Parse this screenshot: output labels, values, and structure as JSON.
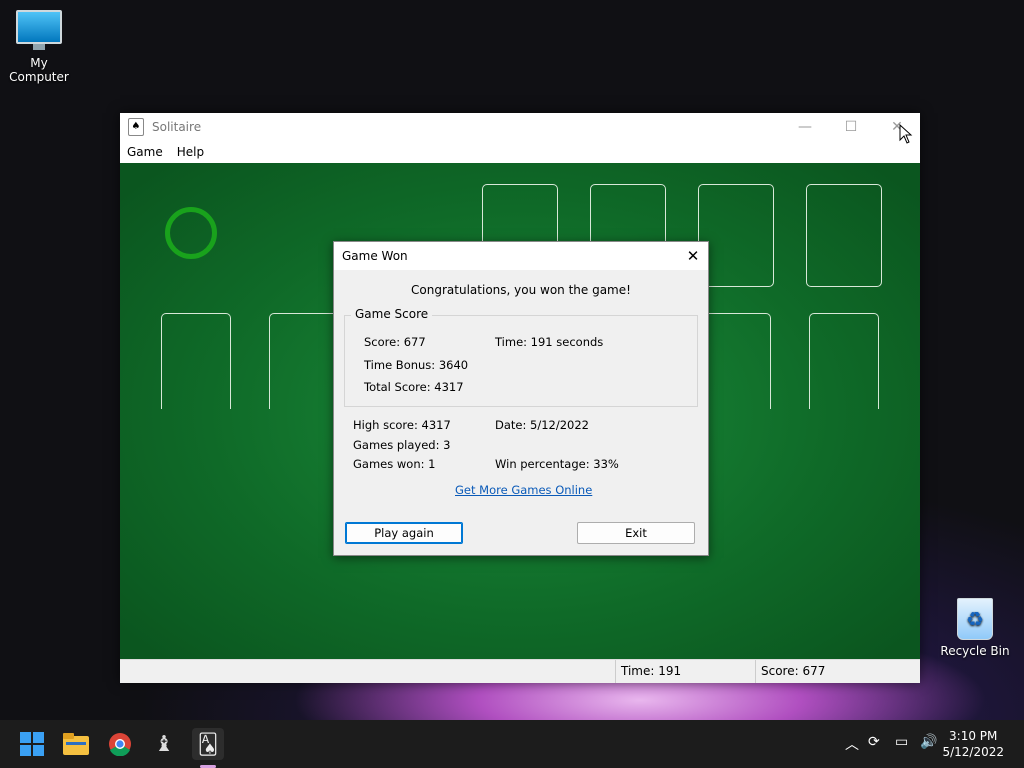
{
  "desktop": {
    "icons": [
      {
        "label": "My Computer",
        "icon": "monitor-icon"
      },
      {
        "label": "Recycle Bin",
        "icon": "recycle-bin-icon"
      }
    ]
  },
  "window": {
    "title": "Solitaire",
    "menu": [
      "Game",
      "Help"
    ],
    "controls": {
      "minimize": "—",
      "maximize": "☐",
      "close": "✕"
    },
    "status": {
      "time_label": "Time:  191",
      "score_label": "Score: 677"
    }
  },
  "dialog": {
    "title": "Game Won",
    "message": "Congratulations, you won the game!",
    "group_title": "Game Score",
    "score": "Score: 677",
    "time": "Time:  191 seconds",
    "time_bonus": "Time Bonus: 3640",
    "total_score": "Total Score: 4317",
    "high_score": "High score: 4317",
    "date": "Date: 5/12/2022",
    "games_played": "Games played: 3",
    "games_won": "Games won: 1",
    "win_percentage": "Win percentage: 33%",
    "link": "Get More Games Online",
    "play_again": "Play again",
    "exit": "Exit"
  },
  "taskbar": {
    "apps": [
      "start-icon",
      "file-explorer-icon",
      "chrome-icon",
      "chess-icon",
      "solitaire-icon"
    ],
    "tray": [
      "chevron-up-icon",
      "update-icon",
      "network-icon",
      "volume-icon"
    ],
    "time": "3:10 PM",
    "date": "5/12/2022"
  },
  "colors": {
    "felt": "#0f6a28",
    "accent": "#0078d4",
    "taskbar": "#1c1c1c"
  }
}
